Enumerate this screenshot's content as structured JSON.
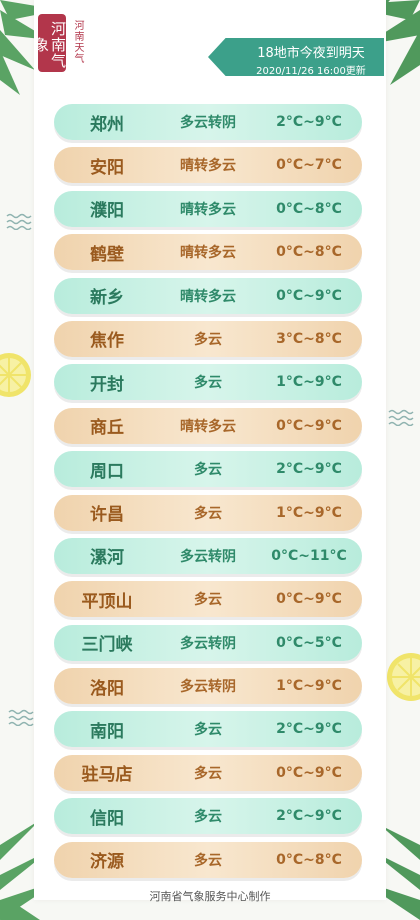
{
  "logo": {
    "text": "河南气象",
    "subtitle": "河南天气"
  },
  "header": {
    "title": "18地市今夜到明天",
    "date": "2020/11/26 16:00更新"
  },
  "rows": [
    {
      "city": "郑州",
      "weather": "多云转阴",
      "temp": "2°C~9°C",
      "style": "green"
    },
    {
      "city": "安阳",
      "weather": "晴转多云",
      "temp": "0°C~7°C",
      "style": "tan"
    },
    {
      "city": "濮阳",
      "weather": "晴转多云",
      "temp": "0°C~8°C",
      "style": "green"
    },
    {
      "city": "鹤壁",
      "weather": "晴转多云",
      "temp": "0°C~8°C",
      "style": "tan"
    },
    {
      "city": "新乡",
      "weather": "晴转多云",
      "temp": "0°C~9°C",
      "style": "green"
    },
    {
      "city": "焦作",
      "weather": "多云",
      "temp": "3°C~8°C",
      "style": "tan"
    },
    {
      "city": "开封",
      "weather": "多云",
      "temp": "1°C~9°C",
      "style": "green"
    },
    {
      "city": "商丘",
      "weather": "晴转多云",
      "temp": "0°C~9°C",
      "style": "tan"
    },
    {
      "city": "周口",
      "weather": "多云",
      "temp": "2°C~9°C",
      "style": "green"
    },
    {
      "city": "许昌",
      "weather": "多云",
      "temp": "1°C~9°C",
      "style": "tan"
    },
    {
      "city": "漯河",
      "weather": "多云转阴",
      "temp": "0°C~11°C",
      "style": "green"
    },
    {
      "city": "平顶山",
      "weather": "多云",
      "temp": "0°C~9°C",
      "style": "tan"
    },
    {
      "city": "三门峡",
      "weather": "多云转阴",
      "temp": "0°C~5°C",
      "style": "green"
    },
    {
      "city": "洛阳",
      "weather": "多云转阴",
      "temp": "1°C~9°C",
      "style": "tan"
    },
    {
      "city": "南阳",
      "weather": "多云",
      "temp": "2°C~9°C",
      "style": "green"
    },
    {
      "city": "驻马店",
      "weather": "多云",
      "temp": "0°C~9°C",
      "style": "tan"
    },
    {
      "city": "信阳",
      "weather": "多云",
      "temp": "2°C~9°C",
      "style": "green"
    },
    {
      "city": "济源",
      "weather": "多云",
      "temp": "0°C~8°C",
      "style": "tan"
    }
  ],
  "footer": {
    "text": "河南省气象服务中心制作"
  },
  "colors": {
    "green_row": "#b8ecdc",
    "tan_row": "#f0d3ad",
    "banner": "#3ca08a",
    "logo": "#b2364b"
  },
  "icons": [
    "palm-leaf-icon",
    "lemon-slice-icon",
    "wave-pattern-icon"
  ]
}
